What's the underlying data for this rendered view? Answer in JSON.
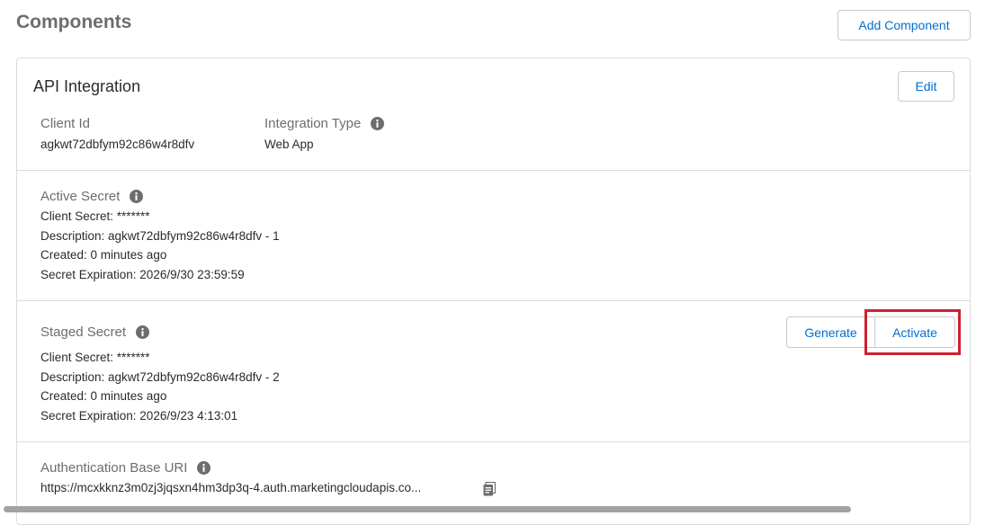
{
  "header": {
    "title": "Components",
    "add_component_label": "Add Component"
  },
  "card": {
    "title": "API Integration",
    "edit_label": "Edit",
    "client_id": {
      "label": "Client Id",
      "value": "agkwt72dbfym92c86w4r8dfv"
    },
    "integration_type": {
      "label": "Integration Type",
      "value": "Web App"
    },
    "active_secret": {
      "label": "Active Secret",
      "client_secret": "Client Secret: *******",
      "description": "Description: agkwt72dbfym92c86w4r8dfv - 1",
      "created": "Created: 0 minutes ago",
      "expiration": "Secret Expiration: 2026/9/30 23:59:59"
    },
    "staged_secret": {
      "label": "Staged Secret",
      "client_secret": "Client Secret: *******",
      "description": "Description: agkwt72dbfym92c86w4r8dfv - 2",
      "created": "Created: 0 minutes ago",
      "expiration": "Secret Expiration: 2026/9/23 4:13:01",
      "generate_label": "Generate",
      "activate_label": "Activate"
    },
    "auth_base_uri": {
      "label": "Authentication Base URI",
      "value": "https://mcxkknz3m0zj3jqsxn4hm3dp3q-4.auth.marketingcloudapis.co..."
    }
  },
  "icons": {
    "info": "info-icon",
    "copy": "copy-icon"
  },
  "colors": {
    "link_blue": "#0070d2",
    "highlight_red": "#d0202e",
    "border_gray": "#dddbda"
  }
}
